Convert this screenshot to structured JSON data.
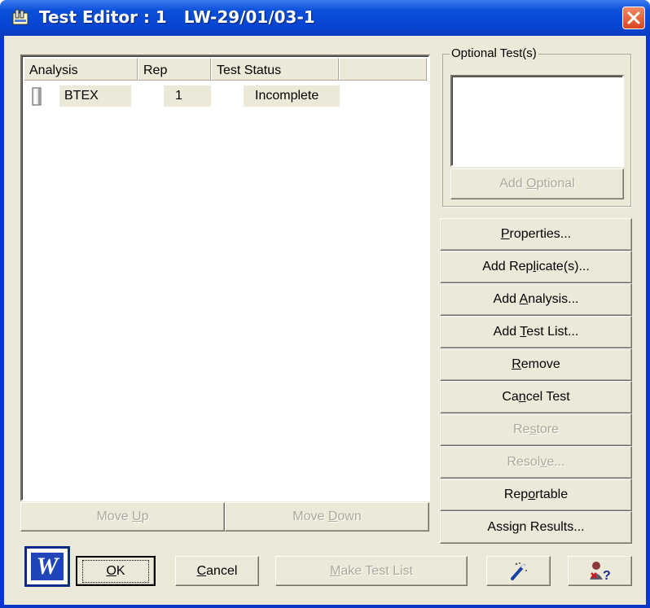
{
  "window": {
    "title": "Test Editor : 1   LW-29/01/03-1",
    "close_icon": "close-icon"
  },
  "table": {
    "columns": [
      "Analysis",
      "Rep",
      "Test Status"
    ],
    "rows": [
      {
        "analysis": "BTEX",
        "rep": "1",
        "status": "Incomplete",
        "icon": "test-tube-icon"
      }
    ]
  },
  "move": {
    "up": {
      "pre": "Move ",
      "key": "U",
      "post": "p"
    },
    "down": {
      "pre": "Move ",
      "key": "D",
      "post": "own"
    }
  },
  "optional": {
    "label": "Optional Test(s)",
    "add": {
      "pre": "Add ",
      "key": "O",
      "post": "ptional"
    }
  },
  "actions": [
    {
      "pre": "",
      "key": "P",
      "post": "roperties...",
      "enabled": true
    },
    {
      "pre": "Add Rep",
      "key": "l",
      "post": "icate(s)...",
      "enabled": true
    },
    {
      "pre": "Add ",
      "key": "A",
      "post": "nalysis...",
      "enabled": true
    },
    {
      "pre": "Add ",
      "key": "T",
      "post": "est List...",
      "enabled": true
    },
    {
      "pre": "",
      "key": "R",
      "post": "emove",
      "enabled": true
    },
    {
      "pre": "Ca",
      "key": "n",
      "post": "cel Test",
      "enabled": true
    },
    {
      "pre": "Re",
      "key": "s",
      "post": "tore",
      "enabled": false
    },
    {
      "pre": "Resol",
      "key": "v",
      "post": "e...",
      "enabled": false
    },
    {
      "pre": "Rep",
      "key": "o",
      "post": "rtable",
      "enabled": true
    },
    {
      "pre": "Assign Results...",
      "key": "",
      "post": "",
      "enabled": true
    }
  ],
  "bottom": {
    "ok": {
      "pre": "",
      "key": "O",
      "post": "K"
    },
    "cancel": {
      "pre": "",
      "key": "C",
      "post": "ancel"
    },
    "make": {
      "pre": "",
      "key": "M",
      "post": "ake Test List"
    },
    "word_icon_letter": "W"
  }
}
